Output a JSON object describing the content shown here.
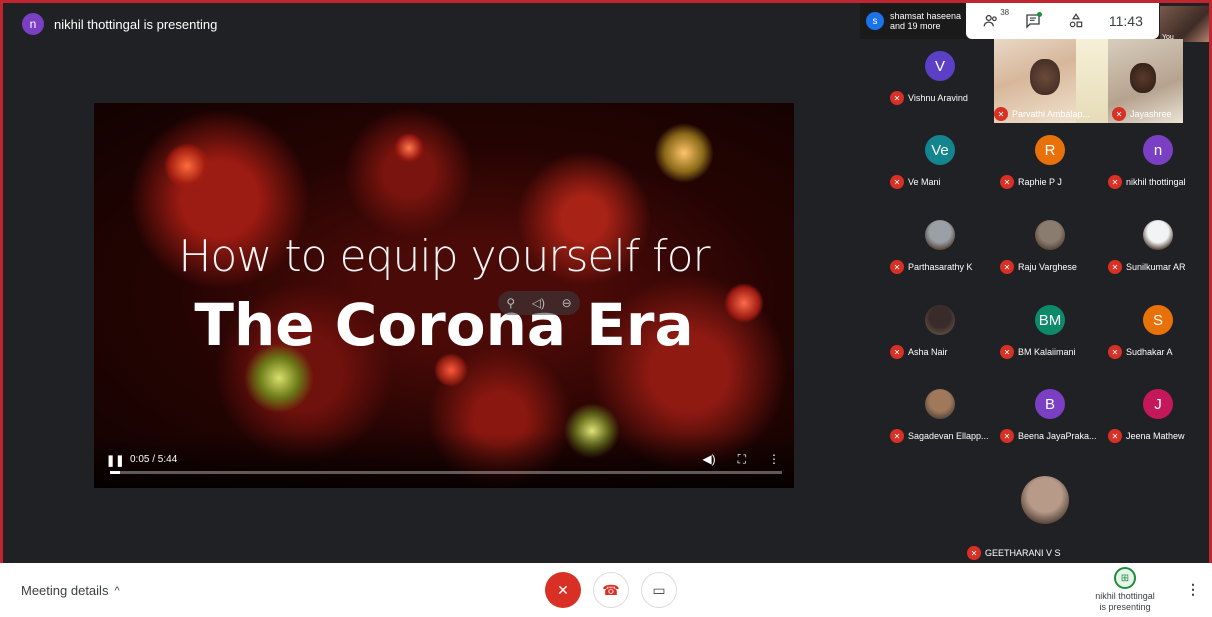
{
  "presenter_banner": {
    "avatar_letter": "n",
    "text": "nikhil thottingal is presenting"
  },
  "pinned": {
    "avatar_letter": "s",
    "line1": "shamsat haseena",
    "line2": "and 19 more"
  },
  "top_controls": {
    "people_count": "38",
    "clock": "11:43",
    "self_label": "You"
  },
  "slide": {
    "line1": "How to equip yourself for",
    "line2": "The Corona Era"
  },
  "video": {
    "time": "0:05 / 5:44",
    "progress": 0.015
  },
  "video_tiles": [
    {
      "name": "Parvathi Ambalap..."
    },
    {
      "name": "Jayashree"
    }
  ],
  "participants": [
    {
      "name": "Vishnu Aravind",
      "initials": "V",
      "color": "#5b3fc4"
    },
    {
      "name": "Ve Mani",
      "initials": "Ve",
      "color": "#12858e"
    },
    {
      "name": "Raphie P J",
      "initials": "R",
      "color": "#e8710a"
    },
    {
      "name": "nikhil thottingal",
      "initials": "n",
      "color": "#7b3fc4"
    },
    {
      "name": "Parthasarathy K",
      "initials": "",
      "color": "#9aa0a6"
    },
    {
      "name": "Raju Varghese",
      "initials": "",
      "color": "#8a7c6e"
    },
    {
      "name": "Sunilkumar AR",
      "initials": "",
      "color": "#f1f3f4"
    },
    {
      "name": "Asha Nair",
      "initials": "",
      "color": "#3a2b2b"
    },
    {
      "name": "BM Kalaiimani",
      "initials": "BM",
      "color": "#0d8a6a"
    },
    {
      "name": "Sudhakar A",
      "initials": "S",
      "color": "#e8710a"
    },
    {
      "name": "Sagadevan Ellapp...",
      "initials": "",
      "color": "#a0785a"
    },
    {
      "name": "Beena JayaPraka...",
      "initials": "B",
      "color": "#7b3fc4"
    },
    {
      "name": "Jeena Mathew",
      "initials": "J",
      "color": "#c5185a"
    },
    {
      "name": "GEETHARANI V S",
      "initials": "",
      "color": "#b89a88"
    }
  ],
  "bottom": {
    "meeting_details": "Meeting details",
    "present_line1": "nikhil thottingal",
    "present_line2": "is presenting"
  },
  "colors": {
    "accent_red": "#d93025",
    "frame_red": "#c0262f",
    "present_green": "#1e8e3e"
  }
}
